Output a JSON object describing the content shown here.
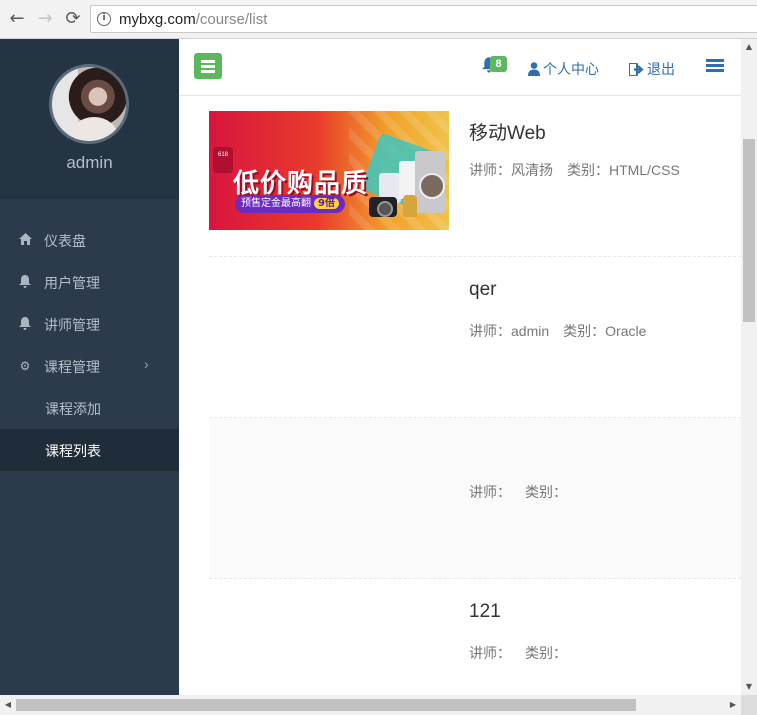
{
  "browser": {
    "url_host": "mybxg.com",
    "url_path": "/course/list",
    "back_icon": "arrow-left",
    "forward_icon": "arrow-right",
    "reload_icon": "reload"
  },
  "sidebar": {
    "admin_name": "admin",
    "items": [
      {
        "label": "仪表盘",
        "icon": "home-icon"
      },
      {
        "label": "用户管理",
        "icon": "bell-icon"
      },
      {
        "label": "讲师管理",
        "icon": "bell-icon"
      },
      {
        "label": "课程管理",
        "icon": "gear-icon"
      },
      {
        "label": "课程添加"
      },
      {
        "label": "课程列表"
      }
    ],
    "active_item": "课程列表",
    "colors": {
      "bg": "#2b3b4c",
      "profile_bg": "#243443",
      "active_bg": "#1f2d3a"
    }
  },
  "topbar": {
    "notification_count": "8",
    "profile_link": "个人中心",
    "logout_link": "退出",
    "accent": "#2f6fad",
    "toggle_color": "#5cb85c"
  },
  "courses": [
    {
      "title": "移动Web",
      "teacher_label": "讲师：风清扬",
      "category_label": "类别：HTML/CSS",
      "has_image": true,
      "banner": {
        "headline": "低价购品质",
        "pill": "预售定金最高翻",
        "multiplier": "9倍",
        "logo": "618"
      }
    },
    {
      "title": "qer",
      "teacher_label": "讲师：admin",
      "category_label": "类别：Oracle",
      "has_image": false
    },
    {
      "title": "",
      "teacher_label": "讲师：",
      "category_label": "类别：",
      "has_image": false
    },
    {
      "title": "121",
      "teacher_label": "讲师：",
      "category_label": "类别：",
      "has_image": false
    }
  ]
}
